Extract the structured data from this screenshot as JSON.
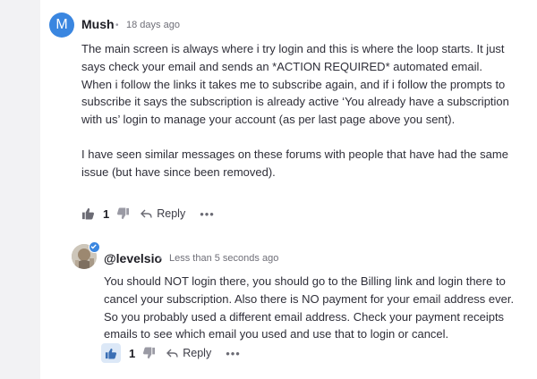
{
  "comment": {
    "avatar_letter": "M",
    "author": "Mush",
    "separator": "•",
    "time": "18 days ago",
    "paragraphs": [
      "The main screen is always where i try login and this is where the loop starts. It just says check your email and sends an *ACTION REQUIRED* automated email. When i follow the links it takes me to subscribe again, and if i follow the prompts to subscribe it says the subscription is already active ‘You already have a subscription with us’ login to manage your account (as per last page above you sent).",
      "I have seen similar messages on these forums with people that have had the same issue (but have since been removed)."
    ],
    "likes": "1",
    "reply_label": "Reply",
    "more_label": "•••"
  },
  "reply": {
    "author": "@levelsio",
    "separator": "•",
    "time": "Less than 5 seconds ago",
    "paragraph": "You should NOT login there, you should go to the Billing link and login there to cancel your subscription. Also there is NO payment for your email address ever. So you probably used a different email address. Check your payment receipts emails to see which email you used and use that to login or cancel.",
    "likes": "1",
    "reply_label": "Reply",
    "more_label": "•••"
  },
  "colors": {
    "avatar_bg": "#3a86e0",
    "like_active_bg": "#dce8f7",
    "icon_gray": "#6b6b74",
    "icon_blue": "#3a6fb5"
  }
}
